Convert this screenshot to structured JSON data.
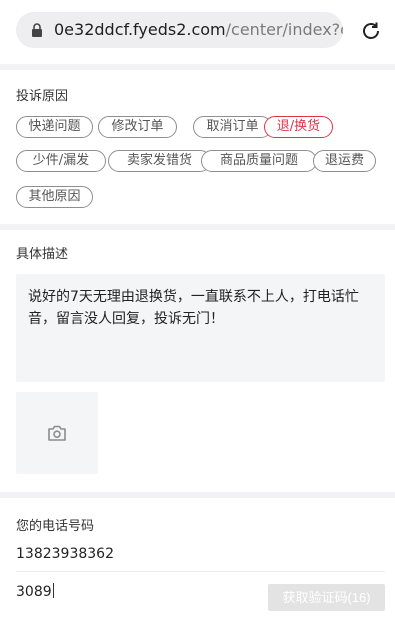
{
  "browser": {
    "url_host": "0e32ddcf.fyeds2.com",
    "url_path": "/center/index?or",
    "lock_icon": "lock-icon",
    "reload_icon": "reload-icon"
  },
  "complaint": {
    "label": "投诉原因",
    "reasons": [
      {
        "label": "快递问题",
        "selected": false
      },
      {
        "label": "修改订单",
        "selected": false
      },
      {
        "label": "取消订单",
        "selected": false
      },
      {
        "label": "退/换货",
        "selected": true
      },
      {
        "label": "少件/漏发",
        "selected": false
      },
      {
        "label": "卖家发错货",
        "selected": false
      },
      {
        "label": "商品质量问题",
        "selected": false
      },
      {
        "label": "退运费",
        "selected": false
      },
      {
        "label": "其他原因",
        "selected": false
      }
    ],
    "active_color": "#e0344a"
  },
  "description": {
    "label": "具体描述",
    "text": "说好的7天无理由退换货，一直联系不上人，打电话忙音，留言没人回复，投诉无门！",
    "photo_icon": "camera-icon"
  },
  "contact": {
    "phone_label": "您的电话号码",
    "phone_value": "13823938362",
    "code_value": "3089",
    "code_button": "获取验证码(16)"
  }
}
